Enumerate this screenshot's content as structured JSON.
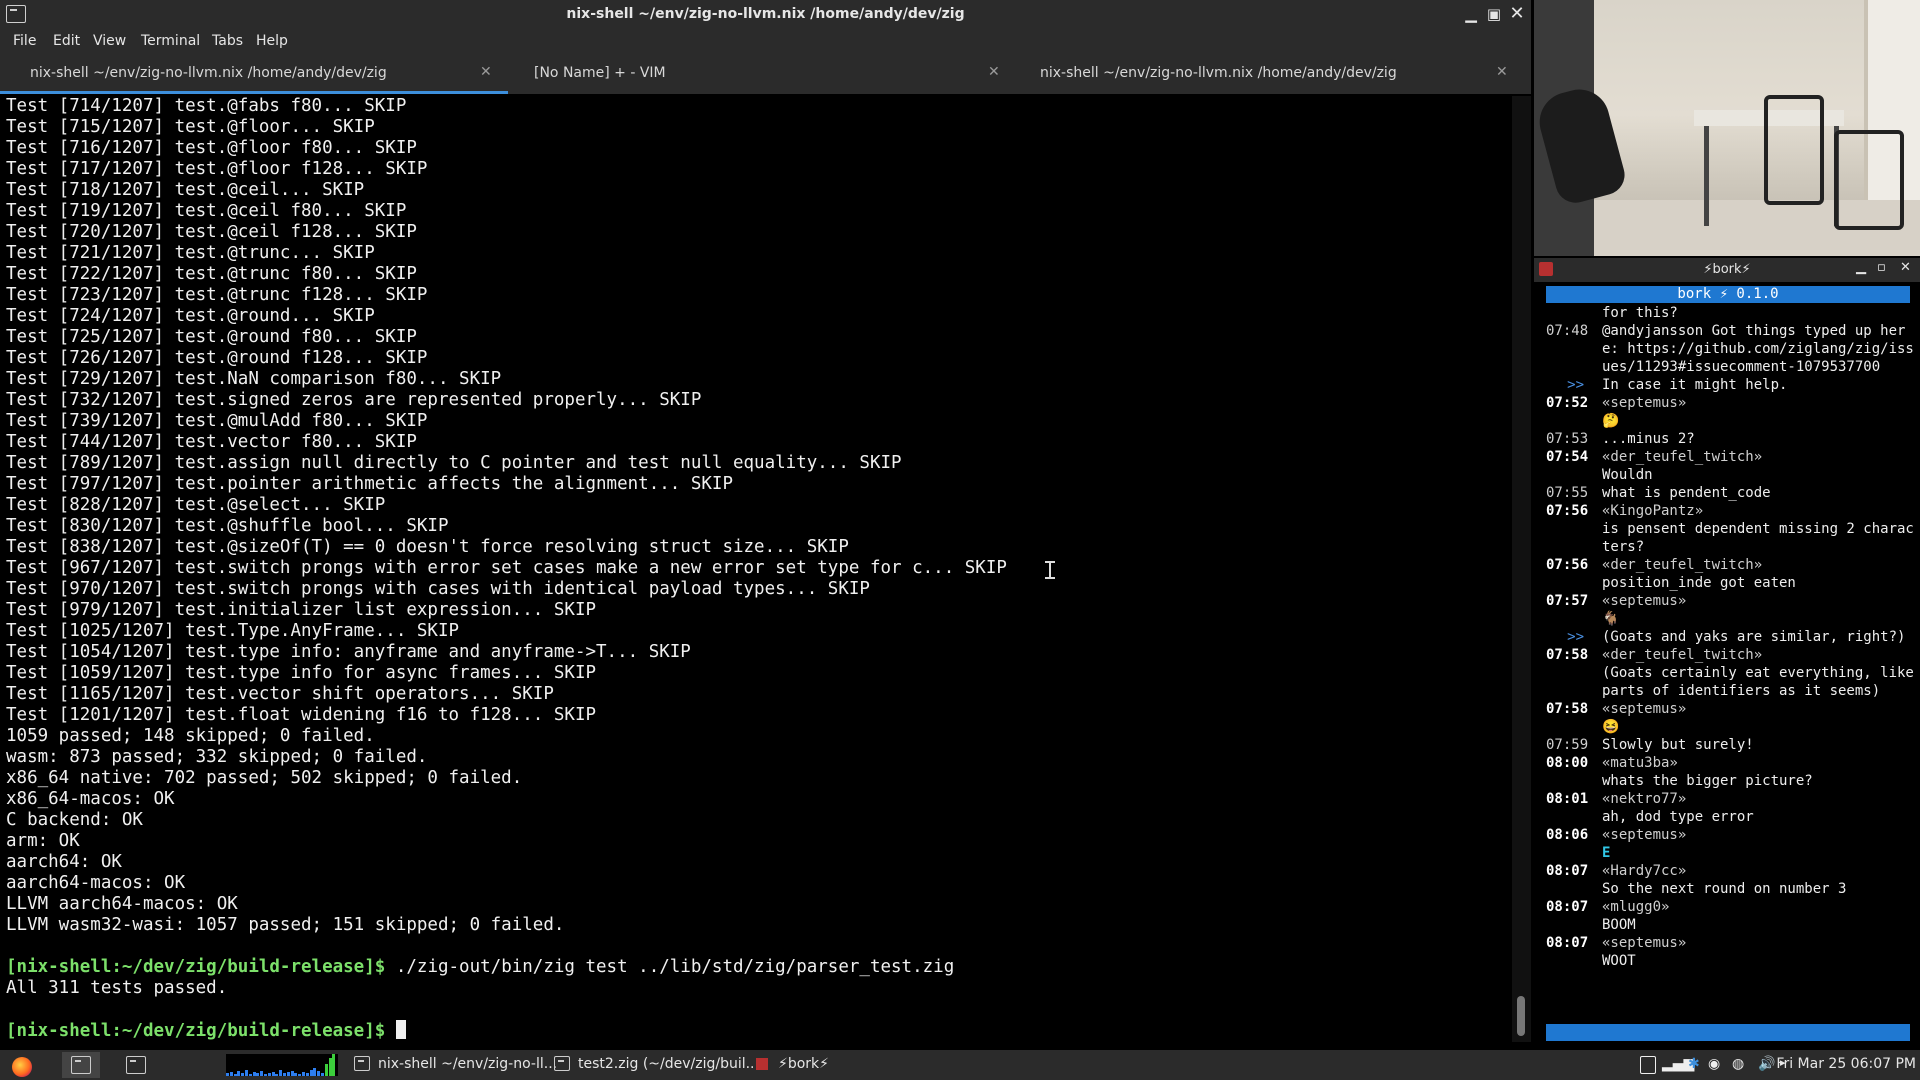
{
  "terminal": {
    "title": "nix-shell ~/env/zig-no-llvm.nix /home/andy/dev/zig",
    "menu": [
      "File",
      "Edit",
      "View",
      "Terminal",
      "Tabs",
      "Help"
    ],
    "tabs": [
      {
        "label": "nix-shell ~/env/zig-no-llvm.nix /home/andy/dev/zig",
        "active": true
      },
      {
        "label": "[No Name] + - VIM",
        "active": false
      },
      {
        "label": "nix-shell ~/env/zig-no-llvm.nix /home/andy/dev/zig",
        "active": false
      }
    ],
    "lines": [
      "Test [714/1207] test.@fabs f80... SKIP",
      "Test [715/1207] test.@floor... SKIP",
      "Test [716/1207] test.@floor f80... SKIP",
      "Test [717/1207] test.@floor f128... SKIP",
      "Test [718/1207] test.@ceil... SKIP",
      "Test [719/1207] test.@ceil f80... SKIP",
      "Test [720/1207] test.@ceil f128... SKIP",
      "Test [721/1207] test.@trunc... SKIP",
      "Test [722/1207] test.@trunc f80... SKIP",
      "Test [723/1207] test.@trunc f128... SKIP",
      "Test [724/1207] test.@round... SKIP",
      "Test [725/1207] test.@round f80... SKIP",
      "Test [726/1207] test.@round f128... SKIP",
      "Test [729/1207] test.NaN comparison f80... SKIP",
      "Test [732/1207] test.signed zeros are represented properly... SKIP",
      "Test [739/1207] test.@mulAdd f80... SKIP",
      "Test [744/1207] test.vector f80... SKIP",
      "Test [789/1207] test.assign null directly to C pointer and test null equality... SKIP",
      "Test [797/1207] test.pointer arithmetic affects the alignment... SKIP",
      "Test [828/1207] test.@select... SKIP",
      "Test [830/1207] test.@shuffle bool... SKIP",
      "Test [838/1207] test.@sizeOf(T) == 0 doesn't force resolving struct size... SKIP",
      "Test [967/1207] test.switch prongs with error set cases make a new error set type for c... SKIP",
      "Test [970/1207] test.switch prongs with cases with identical payload types... SKIP",
      "Test [979/1207] test.initializer list expression... SKIP",
      "Test [1025/1207] test.Type.AnyFrame... SKIP",
      "Test [1054/1207] test.type info: anyframe and anyframe->T... SKIP",
      "Test [1059/1207] test.type info for async frames... SKIP",
      "Test [1165/1207] test.vector shift operators... SKIP",
      "Test [1201/1207] test.float widening f16 to f128... SKIP",
      "1059 passed; 148 skipped; 0 failed.",
      "wasm: 873 passed; 332 skipped; 0 failed.",
      "x86_64 native: 702 passed; 502 skipped; 0 failed.",
      "x86_64-macos: OK",
      "C backend: OK",
      "arm: OK",
      "aarch64: OK",
      "aarch64-macos: OK",
      "LLVM aarch64-macos: OK",
      "LLVM wasm32-wasi: 1057 passed; 151 skipped; 0 failed.",
      ""
    ],
    "prompt": "[nix-shell:~/dev/zig/build-release]$",
    "command": " ./zig-out/bin/zig test ../lib/std/zig/parser_test.zig",
    "command_output": "All 311 tests passed.",
    "prompt2": "[nix-shell:~/dev/zig/build-release]$"
  },
  "bork": {
    "window_title": "⚡bork⚡",
    "header": "bork ⚡ 0.1.0",
    "messages": [
      {
        "time": "",
        "bold": false,
        "text": "for this?"
      },
      {
        "time": "07:48",
        "bold": false,
        "text": "@andyjansson Got things typed up here: https://github.com/ziglang/zig/issues/11293#issuecomment-1079537700"
      },
      {
        "time": ">>",
        "bold": false,
        "arrow": true,
        "text": "In case it might help."
      },
      {
        "time": "07:52",
        "bold": true,
        "text": "«septemus»"
      },
      {
        "time": "",
        "bold": false,
        "text": "🤔"
      },
      {
        "time": "07:53",
        "bold": false,
        "text": "...minus 2?"
      },
      {
        "time": "07:54",
        "bold": true,
        "text": "«der_teufel_twitch»"
      },
      {
        "time": "",
        "bold": false,
        "text": "Wouldn"
      },
      {
        "time": "07:55",
        "bold": false,
        "text": "what is pendent_code"
      },
      {
        "time": "07:56",
        "bold": true,
        "text": "«KingoPantz»"
      },
      {
        "time": "",
        "bold": false,
        "text": "is pensent dependent missing 2 characters?"
      },
      {
        "time": "07:56",
        "bold": true,
        "text": "«der_teufel_twitch»"
      },
      {
        "time": "",
        "bold": false,
        "text": "position_inde got eaten"
      },
      {
        "time": "07:57",
        "bold": true,
        "text": "«septemus»"
      },
      {
        "time": "",
        "bold": false,
        "text": "🐐"
      },
      {
        "time": ">>",
        "bold": false,
        "arrow": true,
        "text": "(Goats and yaks are similar, right?)"
      },
      {
        "time": "07:58",
        "bold": true,
        "text": "«der_teufel_twitch»"
      },
      {
        "time": "",
        "bold": false,
        "text": "(Goats certainly eat everything, like parts of identifiers as it seems)"
      },
      {
        "time": "07:58",
        "bold": true,
        "text": "«septemus»"
      },
      {
        "time": "",
        "bold": false,
        "text": "😆"
      },
      {
        "time": "07:59",
        "bold": false,
        "text": "Slowly but surely!"
      },
      {
        "time": "08:00",
        "bold": true,
        "text": "«matu3ba»"
      },
      {
        "time": "",
        "bold": false,
        "text": "whats the bigger picture?"
      },
      {
        "time": "08:01",
        "bold": true,
        "text": "«nektro77»"
      },
      {
        "time": "",
        "bold": false,
        "text": "ah, dod type error"
      },
      {
        "time": "08:06",
        "bold": true,
        "text": "«septemus»"
      },
      {
        "time": "",
        "bold": false,
        "text": "E",
        "emote": true
      },
      {
        "time": "08:07",
        "bold": true,
        "text": "«Hardy7cc»"
      },
      {
        "time": "",
        "bold": false,
        "text": "So the next round on number 3"
      },
      {
        "time": "08:07",
        "bold": true,
        "text": "«mlugg0»"
      },
      {
        "time": "",
        "bold": false,
        "text": "BOOM"
      },
      {
        "time": "08:07",
        "bold": true,
        "text": "«septemus»"
      },
      {
        "time": "",
        "bold": false,
        "text": "WOOT"
      }
    ]
  },
  "taskbar": {
    "tasks": [
      {
        "label": "nix-shell ~/env/zig-no-ll...",
        "icon": "terminal-icon"
      },
      {
        "label": "test2.zig (~/dev/zig/buil...",
        "icon": "terminal-icon"
      },
      {
        "label": "⚡bork⚡",
        "icon": "bork-icon"
      }
    ],
    "clock": "Fri Mar 25 06:07 PM"
  }
}
